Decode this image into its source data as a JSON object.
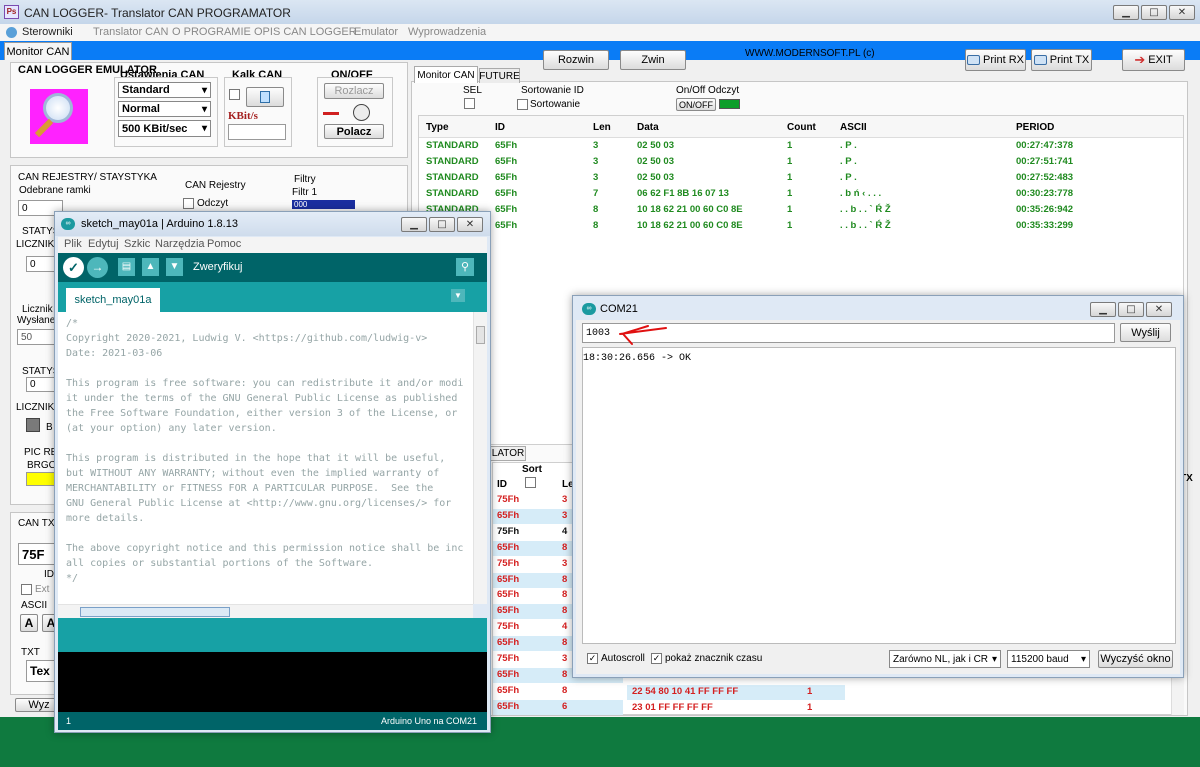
{
  "titlebar": {
    "title": "CAN LOGGER- Translator CAN PROGRAMATOR"
  },
  "menu": [
    "Sterowniki",
    "Translator CAN",
    "O PROGRAMIE",
    "OPIS CAN LOGGER",
    "Emulator",
    "Wyprowadzenia"
  ],
  "toolbar": {
    "tab": "Monitor CAN",
    "expand": "Rozwin",
    "collapse": "Zwin",
    "site": "WWW.MODERNSOFT.PL  (c)",
    "print_rx": "Print RX",
    "print_tx": "Print TX",
    "exit": "EXIT"
  },
  "left": {
    "emulator_title": "CAN LOGGER EMULATOR",
    "settings_title": "Ustawienia CAN",
    "settings": [
      "Standard",
      "Normal",
      "500 KBit/sec"
    ],
    "kalk_title": "Kalk CAN",
    "kbits": "KBit/s",
    "onoff_title": "ON/OFF",
    "disconnect": "Rozlacz",
    "connect": "Polacz",
    "registers_title": "CAN REJESTRY/ STAYSTYKA",
    "received": "Odebrane ramki",
    "received_val": "0",
    "can_registers": "CAN Rejestry",
    "read": "Odczyt",
    "filters": "Filtry",
    "filter1": "Filtr 1",
    "filter1_val": "000",
    "stat1": "STATYS",
    "counter1": "LICZNIK",
    "count1_val": "0",
    "counter_label": "Licznik W",
    "sent": "Wysłane",
    "sent_val": "50",
    "stat2": "STATYS",
    "stat2_val": "0",
    "counter2": "LICZNIK",
    "b_label": "B",
    "pic_label": "PIC RE",
    "brg_label": "BRGC",
    "can_tx": "CAN TX",
    "tx_id": "75F",
    "id_label": "ID",
    "ext_label": "Ext",
    "ascii_label": "ASCII",
    "a_btn": "A",
    "txt_label": "TXT",
    "tex": "Tex",
    "wy": "Wyz"
  },
  "monitor": {
    "tabs": [
      "Monitor CAN",
      "FUTURE"
    ],
    "sel": "SEL",
    "sort_id": "Sortowanie ID",
    "sort_label": "Sortowanie",
    "onoff_read": "On/Off Odczyt",
    "onoff_btn": "ON/OFF",
    "columns": [
      "Type",
      "ID",
      "Len",
      "Data",
      "Count",
      "ASCII",
      "PERIOD"
    ],
    "rows": [
      [
        "STANDARD",
        "65Fh",
        "3",
        "02 50 03",
        "1",
        ". P .",
        "00:27:47:378"
      ],
      [
        "STANDARD",
        "65Fh",
        "3",
        "02 50 03",
        "1",
        ". P .",
        "00:27:51:741"
      ],
      [
        "STANDARD",
        "65Fh",
        "3",
        "02 50 03",
        "1",
        ". P .",
        "00:27:52:483"
      ],
      [
        "STANDARD",
        "65Fh",
        "7",
        "06 62 F1 8B 16 07 13",
        "1",
        ". b ń ‹ . . .",
        "00:30:23:778"
      ],
      [
        "STANDARD",
        "65Fh",
        "8",
        "10 18 62 21 00 60 C0 8E",
        "1",
        ". . b . . ` Ŕ Ž",
        "00:35:26:942"
      ],
      [
        "STANDARD",
        "65Fh",
        "8",
        "10 18 62 21 00 60 C0 8E",
        "1",
        ". . b . . ` Ŕ Ž",
        "00:35:33:299"
      ]
    ]
  },
  "emulator_panel": {
    "tab": "LATOR",
    "sort": "Sort",
    "id_col": "ID",
    "len_col": "Le",
    "tx_label": "TX",
    "rows": [
      {
        "id": "75Fh",
        "len": "3",
        "color": "#d42020"
      },
      {
        "id": "65Fh",
        "len": "3",
        "color": "#d42020"
      },
      {
        "id": "75Fh",
        "len": "4",
        "color": "#111111"
      },
      {
        "id": "65Fh",
        "len": "8",
        "color": "#d42020"
      },
      {
        "id": "75Fh",
        "len": "3",
        "color": "#d42020"
      },
      {
        "id": "65Fh",
        "len": "8",
        "color": "#d42020"
      },
      {
        "id": "65Fh",
        "len": "8",
        "color": "#d42020"
      },
      {
        "id": "65Fh",
        "len": "8",
        "color": "#d42020"
      },
      {
        "id": "75Fh",
        "len": "4",
        "color": "#d42020"
      },
      {
        "id": "65Fh",
        "len": "8",
        "color": "#d42020"
      },
      {
        "id": "75Fh",
        "len": "3",
        "color": "#d42020"
      },
      {
        "id": "65Fh",
        "len": "8",
        "color": "#d42020"
      },
      {
        "id": "65Fh",
        "len": "8",
        "color": "#d42020"
      },
      {
        "id": "65Fh",
        "len": "6",
        "color": "#d42020"
      }
    ],
    "extra_rows": [
      {
        "data": "22 54 80 10 41 FF FF FF",
        "count": "1"
      },
      {
        "data": "23 01 FF FF FF FF",
        "count": "1"
      }
    ]
  },
  "arduino": {
    "title": "sketch_may01a | Arduino 1.8.13",
    "menu": [
      "Plik",
      "Edytuj",
      "Szkic",
      "Narzędzia",
      "Pomoc"
    ],
    "verify": "Zweryfikuj",
    "tab": "sketch_may01a",
    "code": [
      "/*",
      "Copyright 2020-2021, Ludwig V. <https://github.com/ludwig-v>",
      "Date: 2021-03-06",
      "",
      "This program is free software: you can redistribute it and/or modi",
      "it under the terms of the GNU General Public License as published",
      "the Free Software Foundation, either version 3 of the License, or",
      "(at your option) any later version.",
      "",
      "This program is distributed in the hope that it will be useful,",
      "but WITHOUT ANY WARRANTY; without even the implied warranty of",
      "MERCHANTABILITY or FITNESS FOR A PARTICULAR PURPOSE.  See the",
      "GNU General Public License at <http://www.gnu.org/licenses/> for",
      "more details.",
      "",
      "The above copyright notice and this permission notice shall be inc",
      "all copies or substantial portions of the Software.",
      "*/"
    ],
    "status": "Arduino Uno na COM21",
    "line": "1"
  },
  "serial": {
    "title": "COM21",
    "input": "1003",
    "send": "Wyślij",
    "output": "18:30:26.656 -> OK",
    "autoscroll": "Autoscroll",
    "timestamp": "pokaż znacznik czasu",
    "line_ending": "Zarówno NL, jak i CR",
    "baud": "115200 baud",
    "clear": "Wyczyść okno"
  }
}
